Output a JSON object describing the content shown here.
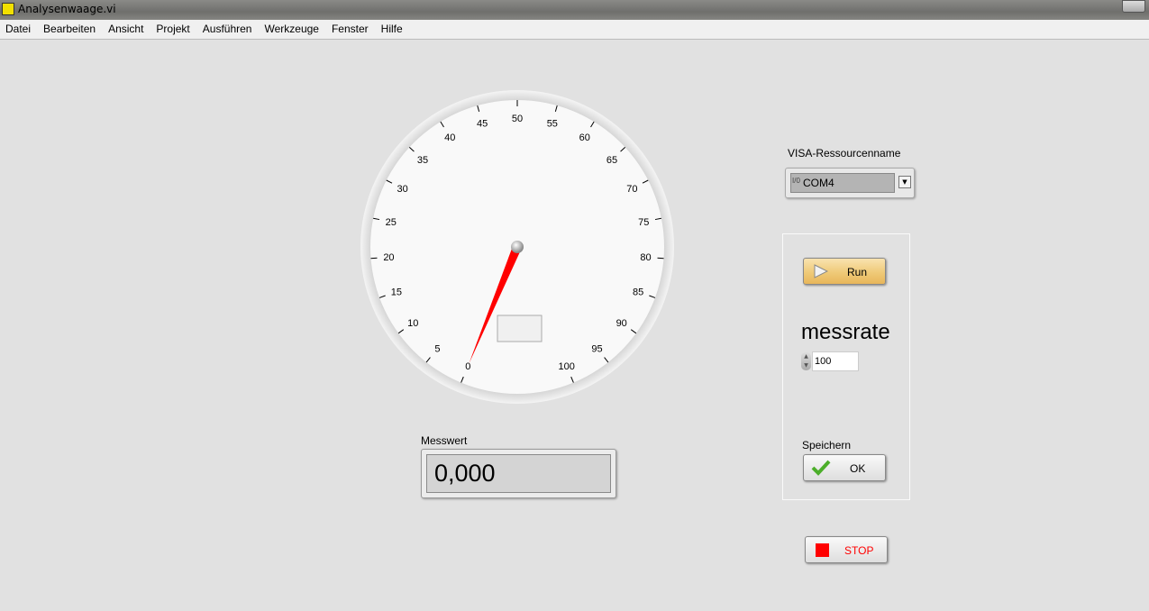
{
  "window": {
    "title": "Analysenwaage.vi"
  },
  "menu": [
    "Datei",
    "Bearbeiten",
    "Ansicht",
    "Projekt",
    "Ausführen",
    "Werkzeuge",
    "Fenster",
    "Hilfe"
  ],
  "gauge": {
    "min": 0,
    "max": 100,
    "major_step": 5,
    "value": 0,
    "needle_color": "#ff0000",
    "labels": [
      "0",
      "5",
      "10",
      "15",
      "20",
      "25",
      "30",
      "35",
      "40",
      "45",
      "50",
      "55",
      "60",
      "65",
      "70",
      "75",
      "80",
      "85",
      "90",
      "95",
      "100"
    ]
  },
  "messwert": {
    "label": "Messwert",
    "value": "0,000"
  },
  "visa": {
    "label": "VISA-Ressourcenname",
    "value": "COM4",
    "io_glyph": "I/0"
  },
  "run": {
    "label": "Run"
  },
  "messrate": {
    "label": "messrate",
    "value": "100"
  },
  "speichern": {
    "label": "Speichern",
    "button": "OK"
  },
  "stop": {
    "label": "STOP",
    "color": "#ff0000"
  }
}
